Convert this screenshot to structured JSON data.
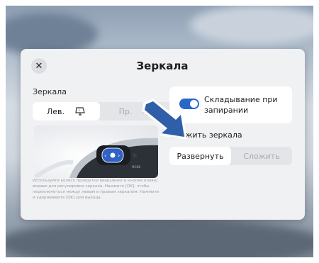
{
  "dialog": {
    "title": "Зеркала",
    "close_icon": "close-icon",
    "mirrors_label": "Зеркала",
    "segment": {
      "left_label": "Лев.",
      "right_label": "Пр.",
      "left_icon": "mirror-left-icon",
      "right_icon": "mirror-right-icon",
      "selected": "left"
    },
    "help_text": "Используйте колесо прокрутки вверх/вниз и кнопки влево/вправо для регулировки зеркала. Нажмите [OK], чтобы переключиться между левым и правым зеркалом. Нажмите и удерживайте [OK] для выхода.",
    "fold_on_lock": {
      "label": "Складывание при запирании",
      "enabled": true
    },
    "fold_section": {
      "label": "Сложить зеркала",
      "unfold_label": "Развернуть",
      "fold_label": "Сложить",
      "selected": "unfold"
    }
  },
  "colors": {
    "accent": "#2b67c9",
    "arrow": "#2f5fa8",
    "dialog_bg": "#f0f1f3"
  }
}
